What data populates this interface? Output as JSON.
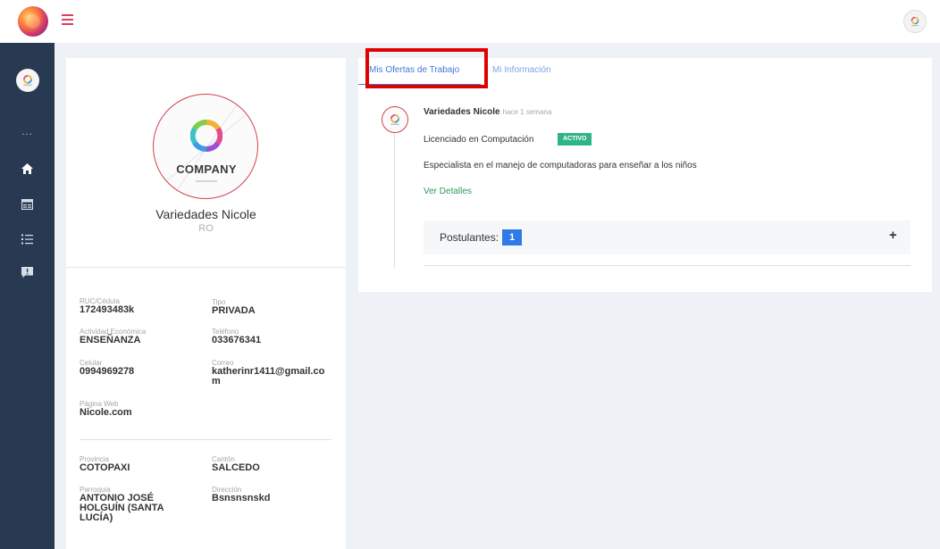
{
  "colors": {
    "sidebar_bg": "#283a52",
    "accent_red": "#e53b5a",
    "tab_blue": "#3e7bd6",
    "active_badge": "#2fb48a",
    "link_green": "#2e9a5a",
    "count_badge": "#2f7ae5",
    "highlight_red": "#e00000"
  },
  "topbar": {
    "logo_icon": "kids-logo-icon",
    "menu_icon": "hamburger-icon",
    "avatar_icon": "company-avatar-icon"
  },
  "sidebar": {
    "avatar_icon": "company-avatar-icon",
    "dots": "...",
    "items": [
      {
        "icon": "home-icon"
      },
      {
        "icon": "card-icon"
      },
      {
        "icon": "list-icon"
      },
      {
        "icon": "message-alert-icon"
      }
    ]
  },
  "profile": {
    "logo_text": "COMPANY",
    "name": "Variedades Nicole",
    "code": "RO",
    "fields": {
      "ruc_label": "RUC/Cédula",
      "ruc_value": "172493483k",
      "tipo_label": "Tipo",
      "tipo_value": "PRIVADA",
      "actividad_label": "Actividad Económica",
      "actividad_value": "ENSEÑANZA",
      "telefono_label": "Teléfono",
      "telefono_value": "033676341",
      "celular_label": "Celular",
      "celular_value": "0994969278",
      "correo_label": "Correo",
      "correo_value": "katherinr1411@gmail.com",
      "web_label": "Página Web",
      "web_value": "Nicole.com",
      "provincia_label": "Provincia",
      "provincia_value": "COTOPAXI",
      "canton_label": "Cantón",
      "canton_value": "SALCEDO",
      "parroquia_label": "Parroquia",
      "parroquia_value": "ANTONIO JOSÉ HOLGUÍN (SANTA LUCÍA)",
      "direccion_label": "Dirección",
      "direccion_value": "Bsnsnsnskd"
    }
  },
  "tabs": {
    "active": "Mis Ofertas de Trabajo",
    "other": "Mi Información"
  },
  "post": {
    "author": "Variedades Nicole",
    "time": "hace 1 semana",
    "title": "Licenciado en Computación",
    "status": "ACTIVO",
    "description": "Especialista en el manejo de computadoras para enseñar a los niños",
    "link": "Ver Detalles",
    "applicants_label": "Postulantes:",
    "applicants_count": "1",
    "expand": "+"
  }
}
